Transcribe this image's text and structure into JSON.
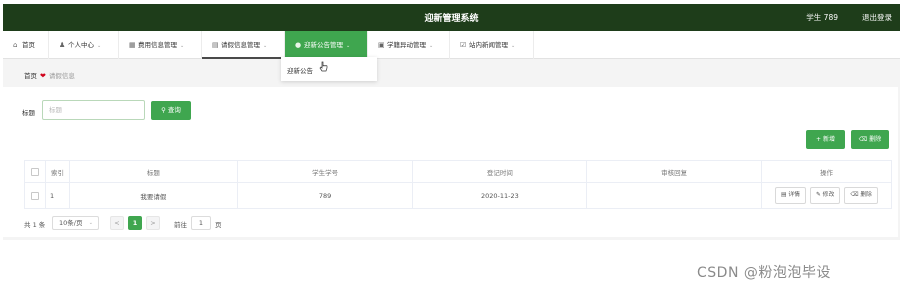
{
  "header": {
    "title": "迎新管理系统",
    "user": "学生 789",
    "logout": "退出登录"
  },
  "nav": {
    "items": [
      {
        "label": "首页",
        "icon": "home-icon"
      },
      {
        "label": "个人中心",
        "icon": "user-icon",
        "caret": "⌄"
      },
      {
        "label": "费用信息管理",
        "icon": "grid-icon",
        "caret": "⌄"
      },
      {
        "label": "请假信息管理",
        "icon": "briefcase-icon",
        "caret": "⌄"
      },
      {
        "label": "迎新公告管理",
        "icon": "chat-icon",
        "caret": "⌄"
      },
      {
        "label": "学籍异动管理",
        "icon": "message-icon",
        "caret": "⌄"
      },
      {
        "label": "站内新闻管理",
        "icon": "check-icon",
        "caret": "⌄"
      }
    ],
    "dropdown_item": "迎新公告"
  },
  "breadcrumb": {
    "home": "首页",
    "current": "请假信息"
  },
  "search": {
    "label": "标题",
    "placeholder": "标题",
    "button": "查询"
  },
  "toolbar": {
    "add": "+ 新增",
    "delete": "删除"
  },
  "table": {
    "columns": [
      "",
      "索引",
      "标题",
      "学生学号",
      "登记时间",
      "审核回复",
      "操作"
    ],
    "rows": [
      {
        "index": "1",
        "title": "我要请假",
        "student_no": "789",
        "date": "2020-11-23",
        "reply": ""
      }
    ],
    "ops": {
      "detail": "详情",
      "edit": "修改",
      "delete": "删除"
    }
  },
  "pager": {
    "total": "共 1 条",
    "page_size": "10条/页",
    "prev": "<",
    "current": "1",
    "next": ">",
    "goto": "前往",
    "goto_value": "1",
    "page_unit": "页"
  },
  "watermark": "CSDN @粉泡泡毕设",
  "colors": {
    "header_bg": "#1e3d1a",
    "accent": "#3fa64f"
  }
}
